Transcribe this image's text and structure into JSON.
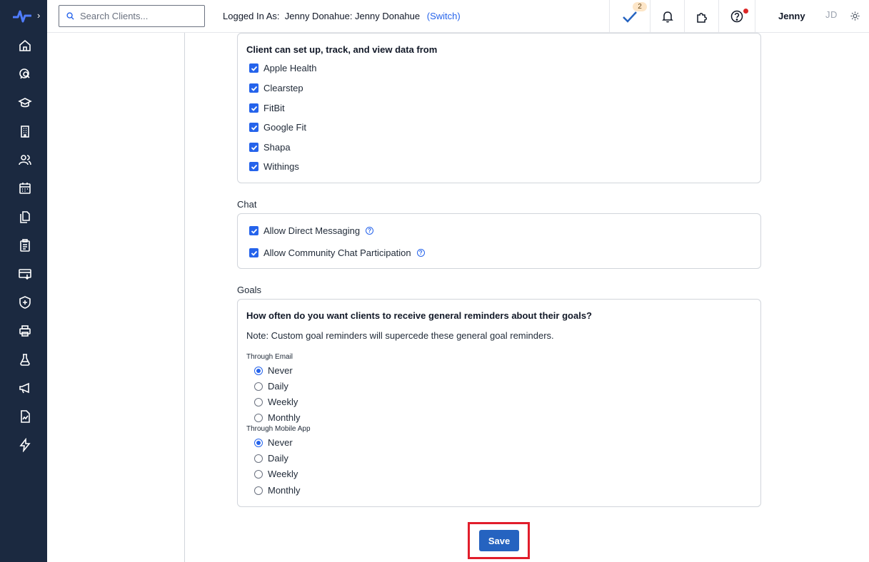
{
  "search": {
    "placeholder": "Search Clients..."
  },
  "session": {
    "logged_label": "Logged In As:",
    "user": "Jenny Donahue: Jenny Donahue",
    "switch_label": "(Switch)"
  },
  "topbar": {
    "tasks_count": "2",
    "user_name": "Jenny",
    "avatar_initials": "JD"
  },
  "sidebar": {
    "icons": [
      "home-icon",
      "chat-search-icon",
      "graduation-cap-icon",
      "building-icon",
      "users-icon",
      "calendar-icon",
      "documents-icon",
      "clipboard-icon",
      "billing-icon",
      "shield-icon",
      "printer-icon",
      "flask-icon",
      "megaphone-icon",
      "report-icon",
      "lightning-icon"
    ]
  },
  "devices": {
    "title": "Client can set up, track, and view data from",
    "items": [
      "Apple Health",
      "Clearstep",
      "FitBit",
      "Google Fit",
      "Shapa",
      "Withings"
    ]
  },
  "chat": {
    "label": "Chat",
    "items": [
      "Allow Direct Messaging",
      "Allow Community Chat Participation"
    ]
  },
  "goals": {
    "label": "Goals",
    "question": "How often do you want clients to receive general reminders about their goals?",
    "note": "Note: Custom goal reminders will supercede these general goal reminders.",
    "email_label": "Through Email",
    "app_label": "Through Mobile App",
    "options": [
      "Never",
      "Daily",
      "Weekly",
      "Monthly"
    ],
    "email_selected": "Never",
    "app_selected": "Never"
  },
  "save_label": "Save",
  "colors": {
    "sidebar": "#1b2940",
    "accent": "#2563eb",
    "highlight": "#e11d2b"
  }
}
